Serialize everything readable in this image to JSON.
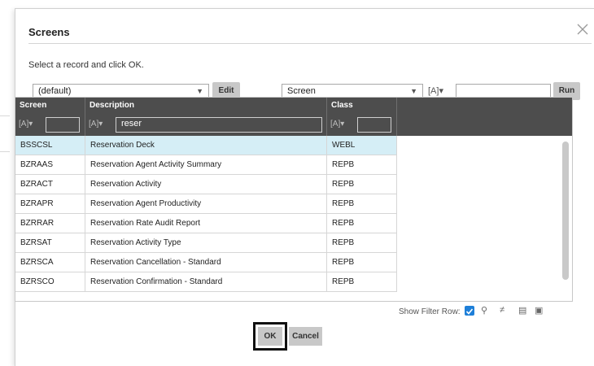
{
  "dialog": {
    "title": "Screens",
    "instruction": "Select a record and click OK."
  },
  "toolbar": {
    "layout_select": "(default)",
    "edit_label": "Edit",
    "field_select": "Screen",
    "filter_glyph": "[A]▾",
    "search_value": "",
    "run_label": "Run"
  },
  "grid": {
    "columns": [
      {
        "label": "Screen",
        "filter_value": ""
      },
      {
        "label": "Description",
        "filter_value": "reser"
      },
      {
        "label": "Class",
        "filter_value": ""
      }
    ],
    "rows": [
      {
        "screen": "BSSCSL",
        "description": "Reservation Deck",
        "class": "WEBL",
        "selected": true
      },
      {
        "screen": "BZRAAS",
        "description": "Reservation Agent Activity Summary",
        "class": "REPB"
      },
      {
        "screen": "BZRACT",
        "description": "Reservation Activity",
        "class": "REPB"
      },
      {
        "screen": "BZRAPR",
        "description": "Reservation Agent Productivity",
        "class": "REPB"
      },
      {
        "screen": "BZRRAR",
        "description": "Reservation Rate Audit Report",
        "class": "REPB"
      },
      {
        "screen": "BZRSAT",
        "description": "Reservation Activity Type",
        "class": "REPB"
      },
      {
        "screen": "BZRSCA",
        "description": "Reservation Cancellation - Standard",
        "class": "REPB"
      },
      {
        "screen": "BZRSCO",
        "description": "Reservation Confirmation - Standard",
        "class": "REPB"
      }
    ]
  },
  "footer": {
    "show_filter_row_label": "Show Filter Row:",
    "show_filter_row_checked": true
  },
  "buttons": {
    "ok_label": "OK",
    "cancel_label": "Cancel"
  },
  "colors": {
    "header_bg": "#4d4d4d",
    "selected_row": "#d5eef6",
    "checkbox": "#1e7fd8"
  }
}
